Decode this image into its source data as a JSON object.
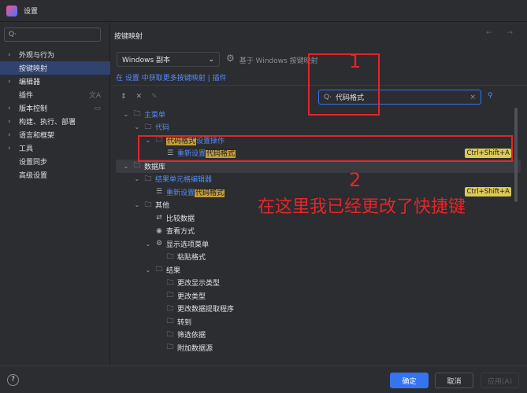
{
  "window": {
    "title": "设置"
  },
  "sidebar": {
    "search_placeholder": "Q·",
    "items": [
      {
        "label": "外观与行为",
        "chev": "›"
      },
      {
        "label": "按键映射",
        "chev": "",
        "selected": true
      },
      {
        "label": "编辑器",
        "chev": "›"
      },
      {
        "label": "插件",
        "chev": "",
        "trail": "文A"
      },
      {
        "label": "版本控制",
        "chev": "›",
        "trail": "▭"
      },
      {
        "label": "构建、执行、部署",
        "chev": "›"
      },
      {
        "label": "语言和框架",
        "chev": "›"
      },
      {
        "label": "工具",
        "chev": "›"
      },
      {
        "label": "设置同步",
        "chev": ""
      },
      {
        "label": "高级设置",
        "chev": ""
      }
    ]
  },
  "main": {
    "header": "按键映射",
    "nav": "← →",
    "keymap_select": "Windows 副本",
    "based_on": "基于 Windows 按键映射",
    "links": {
      "prefix": "在",
      "settings": "设置",
      "middle": "中获取更多按键映射",
      "sep": "|",
      "plugins": "插件"
    },
    "search_value": "代码格式",
    "tree": [
      {
        "level": 0,
        "chev": "⌄",
        "icon": "folder",
        "parts": [
          {
            "t": "主菜单",
            "c": "blue"
          }
        ]
      },
      {
        "level": 1,
        "chev": "⌄",
        "icon": "folder",
        "parts": [
          {
            "t": "代码",
            "c": "blue"
          }
        ]
      },
      {
        "level": 2,
        "chev": "⌄",
        "icon": "folder",
        "parts": [
          {
            "t": "代码格式",
            "c": "mark"
          },
          {
            "t": "设置操作",
            "c": "blue"
          }
        ]
      },
      {
        "level": 3,
        "chev": "",
        "icon": "action",
        "parts": [
          {
            "t": "重新设置",
            "c": "blue"
          },
          {
            "t": "代码格式",
            "c": "mark"
          }
        ],
        "shortcut": "Ctrl+Shift+A"
      },
      {
        "level": 0,
        "chev": "⌄",
        "icon": "folder",
        "parts": [
          {
            "t": "数据库",
            "c": ""
          }
        ],
        "hl": true
      },
      {
        "level": 1,
        "chev": "⌄",
        "icon": "folder",
        "parts": [
          {
            "t": "结果单元格编辑器",
            "c": "blue"
          }
        ]
      },
      {
        "level": 2,
        "chev": "",
        "icon": "action",
        "parts": [
          {
            "t": "重新设置",
            "c": "blue"
          },
          {
            "t": "代码格式",
            "c": "mark"
          }
        ],
        "shortcut": "Ctrl+Shift+A"
      },
      {
        "level": 1,
        "chev": "⌄",
        "icon": "folder",
        "parts": [
          {
            "t": "其他",
            "c": ""
          }
        ]
      },
      {
        "level": 2,
        "chev": "",
        "icon": "compare",
        "parts": [
          {
            "t": "比较数据",
            "c": ""
          }
        ]
      },
      {
        "level": 2,
        "chev": "",
        "icon": "eye",
        "parts": [
          {
            "t": "查看方式",
            "c": ""
          }
        ]
      },
      {
        "level": 2,
        "chev": "⌄",
        "icon": "gear",
        "parts": [
          {
            "t": "显示选项菜单",
            "c": ""
          }
        ]
      },
      {
        "level": 3,
        "chev": "",
        "icon": "folder",
        "parts": [
          {
            "t": "粘贴格式",
            "c": ""
          }
        ]
      },
      {
        "level": 2,
        "chev": "⌄",
        "icon": "folder",
        "parts": [
          {
            "t": "结果",
            "c": ""
          }
        ]
      },
      {
        "level": 3,
        "chev": "",
        "icon": "folder",
        "parts": [
          {
            "t": "更改显示类型",
            "c": ""
          }
        ]
      },
      {
        "level": 3,
        "chev": "",
        "icon": "folder",
        "parts": [
          {
            "t": "更改类型",
            "c": ""
          }
        ]
      },
      {
        "level": 3,
        "chev": "",
        "icon": "folder",
        "parts": [
          {
            "t": "更改数据提取程序",
            "c": ""
          }
        ]
      },
      {
        "level": 3,
        "chev": "",
        "icon": "folder",
        "parts": [
          {
            "t": "转到",
            "c": ""
          }
        ]
      },
      {
        "level": 3,
        "chev": "",
        "icon": "folder",
        "parts": [
          {
            "t": "筛选依据",
            "c": ""
          }
        ]
      },
      {
        "level": 3,
        "chev": "",
        "icon": "folder",
        "parts": [
          {
            "t": "附加数据源",
            "c": ""
          }
        ]
      }
    ]
  },
  "footer": {
    "help": "?",
    "ok": "确定",
    "cancel": "取消",
    "apply": "应用(A)"
  },
  "annotations": {
    "num1": "1",
    "num2": "2",
    "note": "在这里我已经更改了快捷键",
    "color": "#e5252a"
  }
}
